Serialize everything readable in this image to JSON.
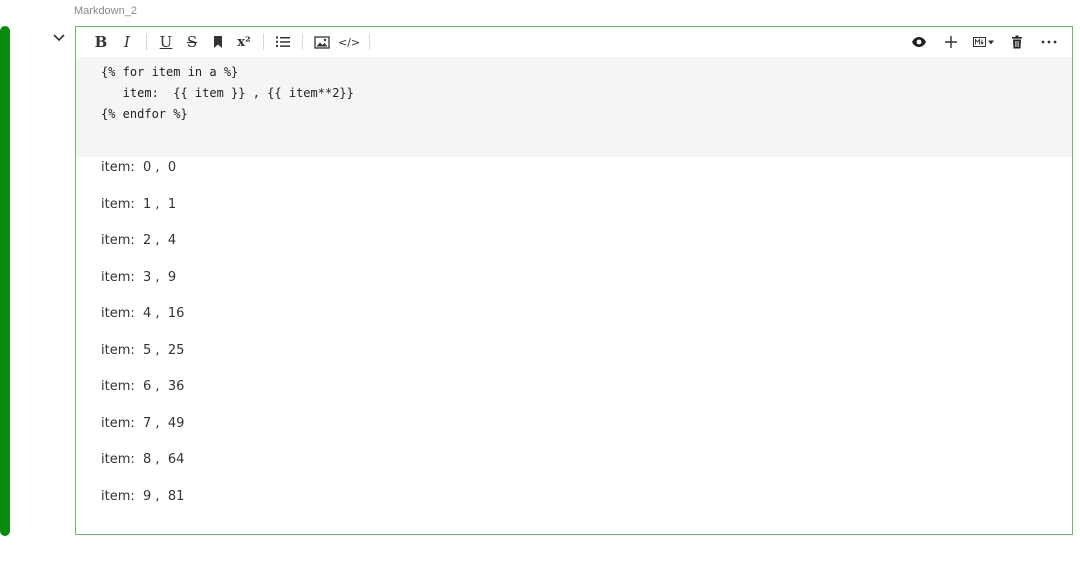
{
  "cell": {
    "title": "Markdown_2",
    "accent_color": "#0a8a10",
    "border_color": "#6db96d"
  },
  "toolbar": {
    "left_buttons": [
      {
        "name": "bold-button",
        "label": "B",
        "icon": "bold-icon"
      },
      {
        "name": "italic-button",
        "label": "I",
        "icon": "italic-icon"
      },
      {
        "name": "underline-button",
        "label": "U",
        "icon": "underline-icon"
      },
      {
        "name": "strikethrough-button",
        "label": "S",
        "icon": "strikethrough-icon"
      },
      {
        "name": "bookmark-button",
        "label": "",
        "icon": "bookmark-icon"
      },
      {
        "name": "superscript-button",
        "label": "x²",
        "icon": "superscript-icon"
      },
      {
        "name": "ordered-list-button",
        "label": "",
        "icon": "ordered-list-icon"
      },
      {
        "name": "image-button",
        "label": "",
        "icon": "image-icon"
      },
      {
        "name": "code-button",
        "label": "</>",
        "icon": "code-icon"
      }
    ],
    "right_buttons": [
      {
        "name": "preview-button",
        "icon": "eye-icon"
      },
      {
        "name": "add-cell-button",
        "icon": "plus-icon"
      },
      {
        "name": "cell-type-button",
        "icon": "markdown-icon"
      },
      {
        "name": "delete-button",
        "icon": "trash-icon"
      },
      {
        "name": "more-button",
        "icon": "more-horizontal-icon"
      }
    ]
  },
  "editor": {
    "lines": [
      "{% for item in a %}",
      "   item:  {{ item }} , {{ item**2}}",
      "{% endfor %}"
    ]
  },
  "output": {
    "lines": [
      "item:  0 ,  0",
      "item:  1 ,  1",
      "item:  2 ,  4",
      "item:  3 ,  9",
      "item:  4 ,  16",
      "item:  5 ,  25",
      "item:  6 ,  36",
      "item:  7 ,  49",
      "item:  8 ,  64",
      "item:  9 ,  81"
    ]
  }
}
